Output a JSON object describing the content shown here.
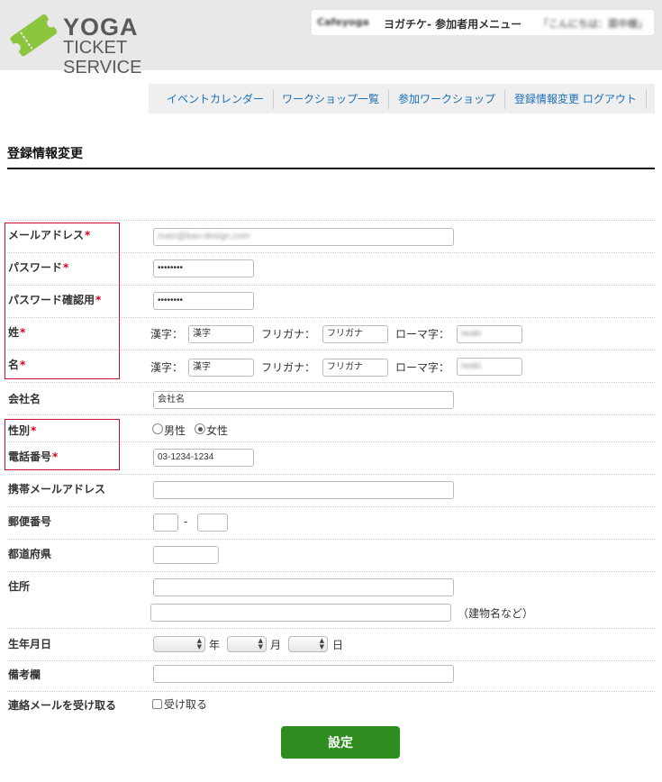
{
  "header": {
    "logo_top": "YOGA",
    "logo_bottom": "TICKET SERVICE",
    "user_name": "Cafeyoga",
    "menu_title": "ヨガチケ- 参加者用メニュー",
    "greeting": "「こんにちは：菜中様」"
  },
  "nav": {
    "items": [
      "イベントカレンダー",
      "ワークショップ一覧",
      "参加ワークショップ",
      "登録情報変更 ログアウト"
    ]
  },
  "page": {
    "title": "登録情報変更"
  },
  "form": {
    "required_mark": "*",
    "email": {
      "label": "メールアドレス",
      "value": "main@kau-design.com"
    },
    "password": {
      "label": "パスワード",
      "value": "••••••••"
    },
    "password_confirm": {
      "label": "パスワード確認用",
      "value": "••••••••"
    },
    "last_name": {
      "label": "姓",
      "kanji_label": "漢字：",
      "kanji_placeholder": "漢字",
      "furigana_label": "フリガナ：",
      "furigana_placeholder": "フリガナ",
      "romaji_label": "ローマ字：",
      "romaji_value": "iwaki"
    },
    "first_name": {
      "label": "名",
      "kanji_label": "漢字：",
      "kanji_placeholder": "漢字",
      "furigana_label": "フリガナ：",
      "furigana_placeholder": "フリガナ",
      "romaji_label": "ローマ字：",
      "romaji_value": "iwaki"
    },
    "company": {
      "label": "会社名",
      "placeholder": "会社名"
    },
    "gender": {
      "label": "性別",
      "options": [
        "男性",
        "女性"
      ],
      "selected": "女性"
    },
    "phone": {
      "label": "電話番号",
      "value": "03-1234-1234"
    },
    "mobile_email": {
      "label": "携帯メールアドレス",
      "value": ""
    },
    "postal": {
      "label": "郵便番号",
      "separator": "-"
    },
    "prefecture": {
      "label": "都道府県",
      "value": ""
    },
    "address": {
      "label": "住所",
      "note": "（建物名など）"
    },
    "birthday": {
      "label": "生年月日",
      "year_unit": "年",
      "month_unit": "月",
      "day_unit": "日"
    },
    "remarks": {
      "label": "備考欄",
      "value": ""
    },
    "mail_opt": {
      "label": "連絡メールを受け取る",
      "checkbox_label": "受け取る"
    },
    "submit_label": "設定"
  },
  "colors": {
    "accent_green": "#2f8c1e",
    "logo_green": "#8cc63f",
    "link_blue": "#1a6fb8",
    "required_red": "#d0021b",
    "highlight_box": "#c8102e"
  }
}
